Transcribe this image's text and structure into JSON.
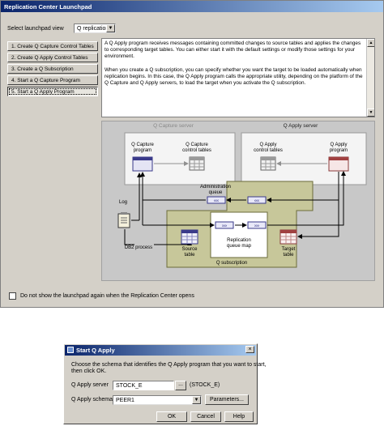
{
  "launchpad": {
    "title": "Replication Center Launchpad",
    "select_label": "Select launchpad view",
    "select_value": "Q replication",
    "steps": [
      {
        "label": "1. Create Q Capture Control Tables"
      },
      {
        "label": "2. Create Q Apply Control Tables"
      },
      {
        "label": "3. Create a Q Subscription"
      },
      {
        "label": "4. Start a Q Capture Program"
      },
      {
        "label": "5. Start a Q Apply Program"
      }
    ],
    "description": {
      "p1": "A Q Apply program receives messages containing committed changes to source tables and applies the changes to corresponding target tables. You can either start it with the default settings or modify those settings for your environment.",
      "p2": "When you create a Q subscription, you can specify whether you want the target to be loaded automatically when replication begins. In this case, the Q Apply program calls the appropriate utility, depending on the platform of the Q Capture and Q Apply servers, to load the target when you activate the Q subscription."
    },
    "diagram": {
      "capture_server": "Q Capture server",
      "apply_server": "Q Apply server",
      "q_capture_program": [
        "Q Capture",
        "program"
      ],
      "q_capture_control_tables": [
        "Q Capture",
        "control tables"
      ],
      "q_apply_control_tables": [
        "Q Apply",
        "control tables"
      ],
      "q_apply_program": [
        "Q Apply",
        "program"
      ],
      "admin_queue": [
        "Administration",
        "queue"
      ],
      "log": "Log",
      "db2_process": "DB2 process",
      "source_table": [
        "Source",
        "table"
      ],
      "repl_queue_map": [
        "Replication",
        "queue map"
      ],
      "target_table": [
        "Target",
        "table"
      ],
      "q_subscription": "Q subscription"
    },
    "checkbox_label": "Do not show the launchpad again when the Replication Center opens"
  },
  "dialog": {
    "title": "Start Q Apply",
    "instructions": [
      "Choose the schema that identifies the Q Apply program that you want to start,",
      "then click OK."
    ],
    "server_label": "Q Apply server",
    "server_value": "STOCK_E",
    "server_browse": "...",
    "server_alias": "(STOCK_E)",
    "schema_label": "Q Apply schema",
    "schema_value": "PEER1",
    "parameters_button": "Parameters...",
    "ok_button": "OK",
    "cancel_button": "Cancel",
    "help_button": "Help"
  }
}
